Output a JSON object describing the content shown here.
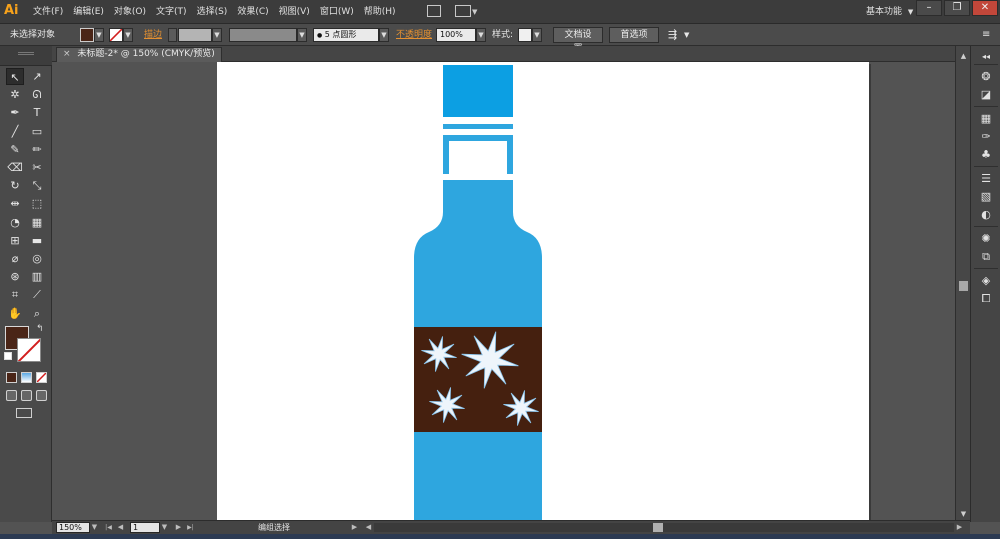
{
  "app": {
    "logo": "Ai"
  },
  "menu": {
    "items": [
      "文件(F)",
      "编辑(E)",
      "对象(O)",
      "文字(T)",
      "选择(S)",
      "效果(C)",
      "视图(V)",
      "窗口(W)",
      "帮助(H)"
    ],
    "workspace": "基本功能",
    "workspace_arrow": "▼",
    "minimize": "–",
    "restore": "❐",
    "close": "✕"
  },
  "control": {
    "selection_status": "未选择对象",
    "stroke_label": "描边",
    "brush_value": "5 点圆形",
    "opacity_label": "不透明度",
    "opacity_value": "100%",
    "style_label": "样式",
    "doc_setup": "文档设置",
    "preferences": "首选项",
    "dd_arrow": "▼",
    "panel_menu": "≡"
  },
  "tab": {
    "close": "×",
    "title": "未标题-2* @ 150% (CMYK/预览)"
  },
  "status": {
    "zoom": "150%",
    "page": "1",
    "tool_status": "编组选择",
    "play": "▶",
    "prev": "◀",
    "next": "▶",
    "first": "|◀",
    "last": "▶|"
  },
  "tools": [
    {
      "name": "selection-tool-icon",
      "glyph": "↖"
    },
    {
      "name": "direct-selection-tool-icon",
      "glyph": "↗"
    },
    {
      "name": "magic-wand-tool-icon",
      "glyph": "✲"
    },
    {
      "name": "lasso-tool-icon",
      "glyph": "ᘏ"
    },
    {
      "name": "pen-tool-icon",
      "glyph": "✒"
    },
    {
      "name": "type-tool-icon",
      "glyph": "T"
    },
    {
      "name": "line-tool-icon",
      "glyph": "╱"
    },
    {
      "name": "rectangle-tool-icon",
      "glyph": "▭"
    },
    {
      "name": "paintbrush-tool-icon",
      "glyph": "✎"
    },
    {
      "name": "pencil-tool-icon",
      "glyph": "✏"
    },
    {
      "name": "blob-brush-tool-icon",
      "glyph": "⌫"
    },
    {
      "name": "scissors-tool-icon",
      "glyph": "✂"
    },
    {
      "name": "rotate-tool-icon",
      "glyph": "↻"
    },
    {
      "name": "scale-tool-icon",
      "glyph": "⤡"
    },
    {
      "name": "width-tool-icon",
      "glyph": "⇹"
    },
    {
      "name": "free-transform-tool-icon",
      "glyph": "⬚"
    },
    {
      "name": "shape-builder-tool-icon",
      "glyph": "◔"
    },
    {
      "name": "perspective-grid-tool-icon",
      "glyph": "▦"
    },
    {
      "name": "mesh-tool-icon",
      "glyph": "⊞"
    },
    {
      "name": "gradient-tool-icon",
      "glyph": "▬"
    },
    {
      "name": "eyedropper-tool-icon",
      "glyph": "⌀"
    },
    {
      "name": "blend-tool-icon",
      "glyph": "◎"
    },
    {
      "name": "symbol-sprayer-tool-icon",
      "glyph": "⊛"
    },
    {
      "name": "graph-tool-icon",
      "glyph": "▥"
    },
    {
      "name": "artboard-tool-icon",
      "glyph": "⌗"
    },
    {
      "name": "slice-tool-icon",
      "glyph": "⟋"
    },
    {
      "name": "hand-tool-icon",
      "glyph": "✋"
    },
    {
      "name": "zoom-tool-icon",
      "glyph": "⌕"
    }
  ],
  "colors": {
    "fill": "#4a2517",
    "bottle_blue": "#2ea6df",
    "cap_blue": "#0c9fe3",
    "label_brown": "#45200f",
    "star": "#eef5fb",
    "star_edge": "#8ec7ee"
  }
}
